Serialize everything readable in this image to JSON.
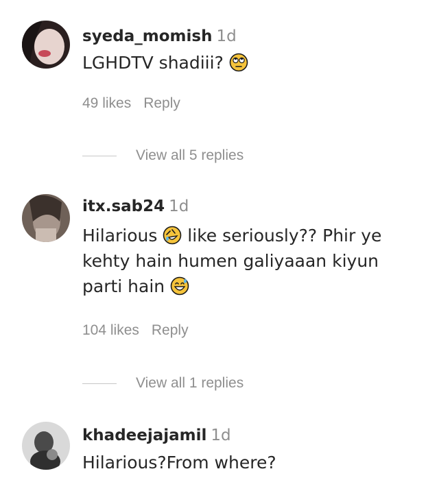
{
  "comments": [
    {
      "username": "syeda_momish",
      "time": "1d",
      "text_parts": [
        "LGHDTV shadiii? "
      ],
      "emoji": [
        "face-with-rolling-eyes"
      ],
      "likes": "49 likes",
      "reply": "Reply",
      "view_replies": "View all 5 replies"
    },
    {
      "username": "itx.sab24",
      "time": "1d",
      "line1_a": "Hilarious ",
      "line1_b": " like seriously?? Phir ye",
      "line2": "kehty hain humen galiyaaan kiyun",
      "line3": "parti hain ",
      "emoji": [
        "rolling-on-floor-laughing",
        "grinning-face-with-sweat"
      ],
      "likes": "104 likes",
      "reply": "Reply",
      "view_replies": "View all 1 replies"
    },
    {
      "username": "khadeejajamil",
      "time": "1d",
      "text": "Hilarious?From where?"
    }
  ],
  "colors": {
    "primary_text": "#262626",
    "secondary_text": "#8e8e8e",
    "emoji_yellow": "#f5c33b"
  }
}
